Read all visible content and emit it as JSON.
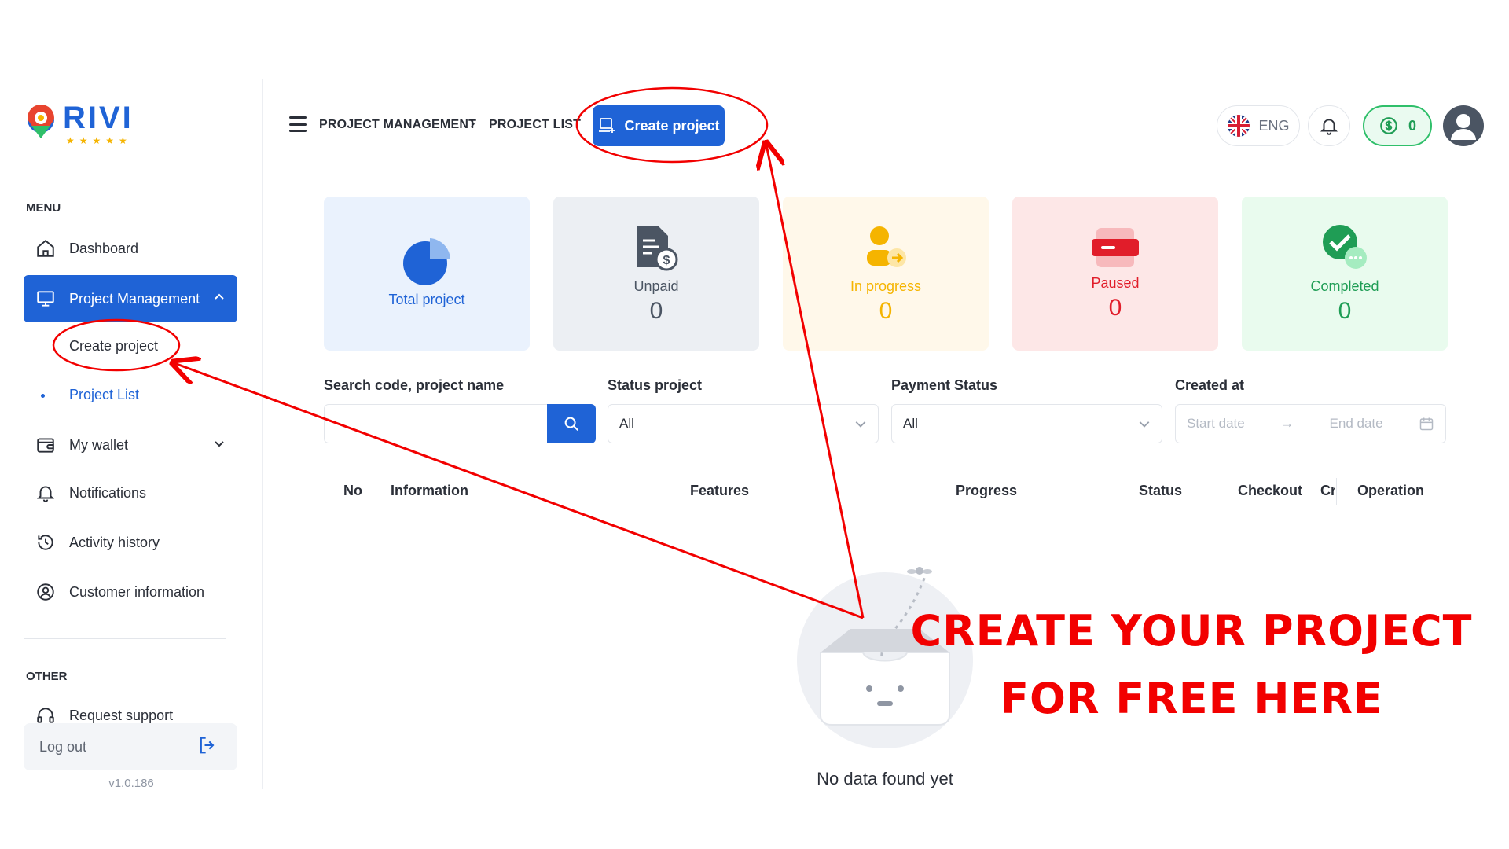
{
  "brand": {
    "name": "RIVI",
    "stars": "★★★★★"
  },
  "sidebar": {
    "menu_label": "MENU",
    "other_label": "OTHER",
    "items": [
      {
        "label": "Dashboard",
        "icon": "home-icon"
      },
      {
        "label": "Project Management",
        "icon": "monitor-icon",
        "expanded": true
      },
      {
        "label": "My wallet",
        "icon": "wallet-icon"
      },
      {
        "label": "Notifications",
        "icon": "bell-icon"
      },
      {
        "label": "Activity history",
        "icon": "history-icon"
      },
      {
        "label": "Customer information",
        "icon": "user-circle-icon"
      }
    ],
    "subitems": [
      {
        "label": "Create project"
      },
      {
        "label": "Project List",
        "current": true
      }
    ],
    "other_items": [
      {
        "label": "Request support",
        "icon": "headset-icon"
      }
    ],
    "logout_label": "Log out",
    "version": "v1.0.186"
  },
  "header": {
    "breadcrumb": [
      "PROJECT MANAGEMENT",
      "PROJECT LIST"
    ],
    "create_button": "Create project",
    "language": "ENG",
    "wallet_balance": "0"
  },
  "stats": [
    {
      "label": "Total project",
      "count": "",
      "bg": "#eaf2fd",
      "color": "#1f63d6"
    },
    {
      "label": "Unpaid",
      "count": "0",
      "bg": "#eceff3",
      "color": "#4b5563"
    },
    {
      "label": "In progress",
      "count": "0",
      "bg": "#fff8ea",
      "color": "#f5b400"
    },
    {
      "label": "Paused",
      "count": "0",
      "bg": "#fde7e7",
      "color": "#e11d2a"
    },
    {
      "label": "Completed",
      "count": "0",
      "bg": "#e9fbee",
      "color": "#1f9d55"
    }
  ],
  "filters": {
    "search_label": "Search code, project name",
    "status_label": "Status project",
    "status_value": "All",
    "payment_label": "Payment Status",
    "payment_value": "All",
    "created_label": "Created at",
    "start_placeholder": "Start date",
    "end_placeholder": "End date"
  },
  "table": {
    "columns": [
      "No",
      "Information",
      "Features",
      "Progress",
      "Status",
      "Checkout",
      "Cr",
      "Operation"
    ]
  },
  "empty_state": "No data found yet",
  "promo": {
    "line1": "CREATE YOUR PROJECT",
    "line2": "FOR FREE HERE"
  },
  "colors": {
    "primary": "#1f63d6",
    "annotation": "#f20000"
  }
}
